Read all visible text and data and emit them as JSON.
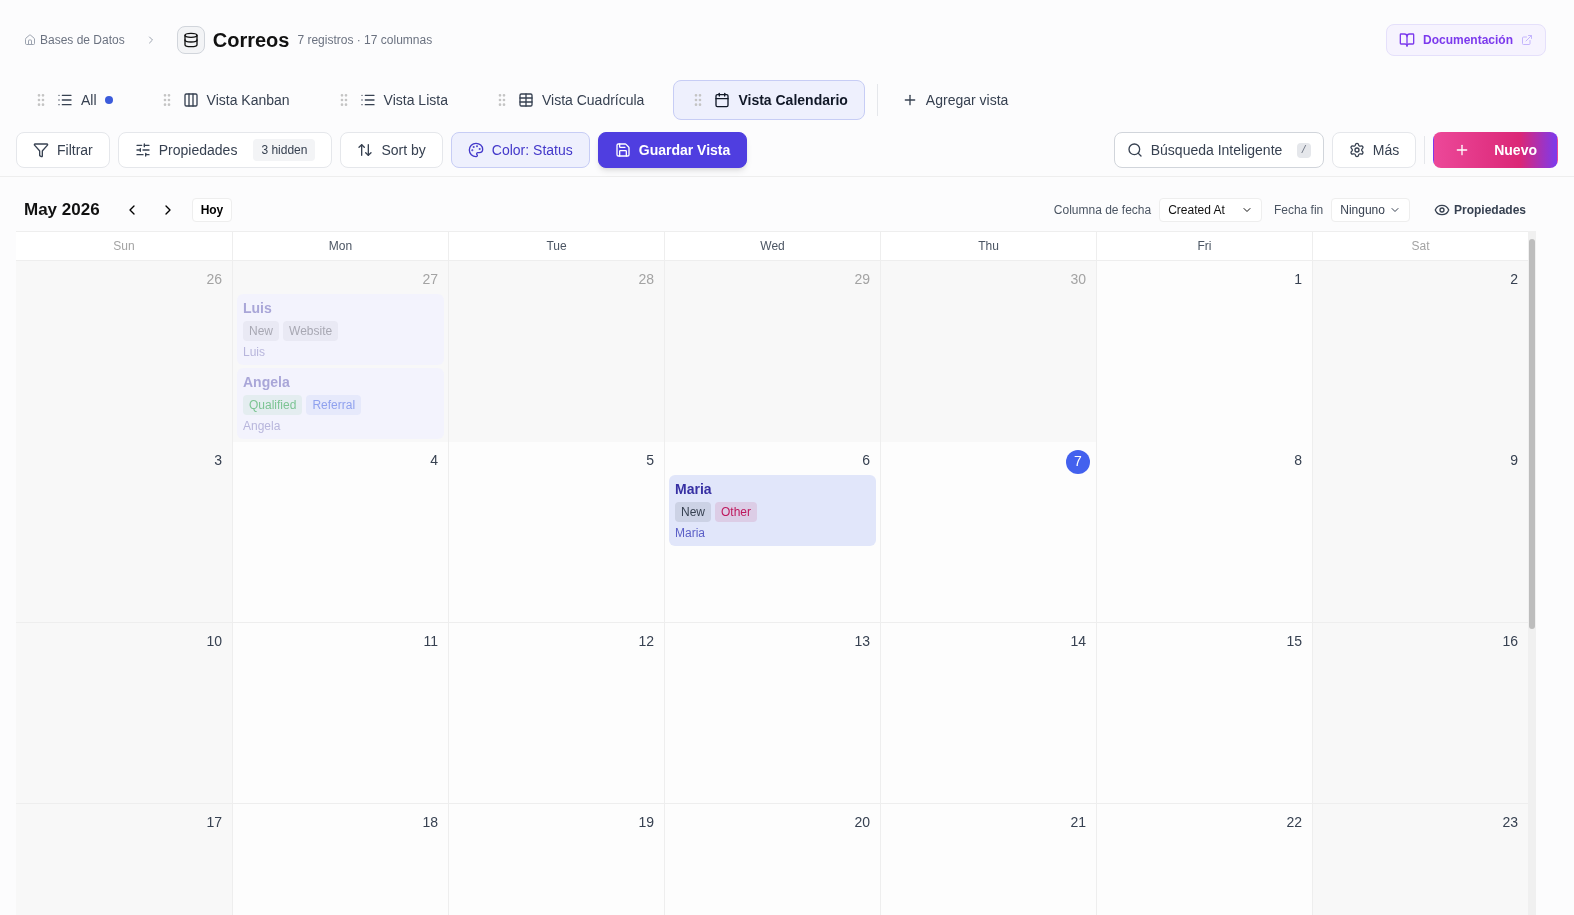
{
  "breadcrumb": {
    "parent": "Bases de Datos",
    "title": "Correos",
    "meta": "7 registros · 17 columnas"
  },
  "docs_button": "Documentación",
  "views": [
    {
      "label": "All",
      "kind": "list",
      "selected": false,
      "dot": true
    },
    {
      "label": "Vista Kanban",
      "kind": "kanban",
      "selected": false,
      "dot": false
    },
    {
      "label": "Vista Lista",
      "kind": "list",
      "selected": false,
      "dot": false
    },
    {
      "label": "Vista Cuadrícula",
      "kind": "grid",
      "selected": false,
      "dot": false
    },
    {
      "label": "Vista Calendario",
      "kind": "calendar",
      "selected": true,
      "dot": false
    }
  ],
  "add_view": "Agregar vista",
  "toolbar": {
    "filter": "Filtrar",
    "properties": "Propiedades",
    "hidden_badge": "3 hidden",
    "sort": "Sort by",
    "color_by": "Color: Status",
    "save": "Guardar Vista",
    "search": "Búsqueda Inteligente",
    "search_key": "/",
    "more": "Más",
    "new": "Nuevo"
  },
  "calendar": {
    "month": "May 2026",
    "today_button": "Hoy",
    "date_column_label": "Columna de fecha",
    "date_column": "Created At",
    "end_label": "Fecha fin",
    "end_value": "Ninguno",
    "properties": "Propiedades",
    "weekdays": [
      {
        "label": "Sun",
        "weekend": true
      },
      {
        "label": "Mon",
        "weekend": false
      },
      {
        "label": "Tue",
        "weekend": false
      },
      {
        "label": "Wed",
        "weekend": false
      },
      {
        "label": "Thu",
        "weekend": false
      },
      {
        "label": "Fri",
        "weekend": false
      },
      {
        "label": "Sat",
        "weekend": true
      }
    ],
    "weeks": [
      [
        {
          "day": "26",
          "in_month": false,
          "today": false
        },
        {
          "day": "27",
          "in_month": false,
          "today": false,
          "events": [
            {
              "title": "Luis",
              "tags": [
                {
                  "label": "New",
                  "color": "#a8a8b3"
                },
                {
                  "label": "Website",
                  "color": "#a8a8b3"
                }
              ],
              "subtitle": "Luis"
            },
            {
              "title": "Angela",
              "tags": [
                {
                  "label": "Qualified",
                  "color": "#7cc493"
                },
                {
                  "label": "Referral",
                  "color": "#8fa1ee"
                }
              ],
              "subtitle": "Angela"
            }
          ]
        },
        {
          "day": "28",
          "in_month": false,
          "today": false
        },
        {
          "day": "29",
          "in_month": false,
          "today": false
        },
        {
          "day": "30",
          "in_month": false,
          "today": false
        },
        {
          "day": "1",
          "in_month": true,
          "today": false
        },
        {
          "day": "2",
          "in_month": true,
          "today": false
        }
      ],
      [
        {
          "day": "3",
          "in_month": true,
          "today": false
        },
        {
          "day": "4",
          "in_month": true,
          "today": false
        },
        {
          "day": "5",
          "in_month": true,
          "today": false
        },
        {
          "day": "6",
          "in_month": true,
          "today": false,
          "events": [
            {
              "title": "Maria",
              "tags": [
                {
                  "label": "New",
                  "color": "#374151"
                },
                {
                  "label": "Other",
                  "color": "#be185d"
                }
              ],
              "subtitle": "Maria"
            }
          ]
        },
        {
          "day": "7",
          "in_month": true,
          "today": true
        },
        {
          "day": "8",
          "in_month": true,
          "today": false
        },
        {
          "day": "9",
          "in_month": true,
          "today": false
        }
      ],
      [
        {
          "day": "10",
          "in_month": true,
          "today": false
        },
        {
          "day": "11",
          "in_month": true,
          "today": false
        },
        {
          "day": "12",
          "in_month": true,
          "today": false
        },
        {
          "day": "13",
          "in_month": true,
          "today": false
        },
        {
          "day": "14",
          "in_month": true,
          "today": false
        },
        {
          "day": "15",
          "in_month": true,
          "today": false
        },
        {
          "day": "16",
          "in_month": true,
          "today": false
        }
      ],
      [
        {
          "day": "17",
          "in_month": true,
          "today": false
        },
        {
          "day": "18",
          "in_month": true,
          "today": false
        },
        {
          "day": "19",
          "in_month": true,
          "today": false
        },
        {
          "day": "20",
          "in_month": true,
          "today": false
        },
        {
          "day": "21",
          "in_month": true,
          "today": false
        },
        {
          "day": "22",
          "in_month": true,
          "today": false
        },
        {
          "day": "23",
          "in_month": true,
          "today": false
        }
      ]
    ]
  }
}
